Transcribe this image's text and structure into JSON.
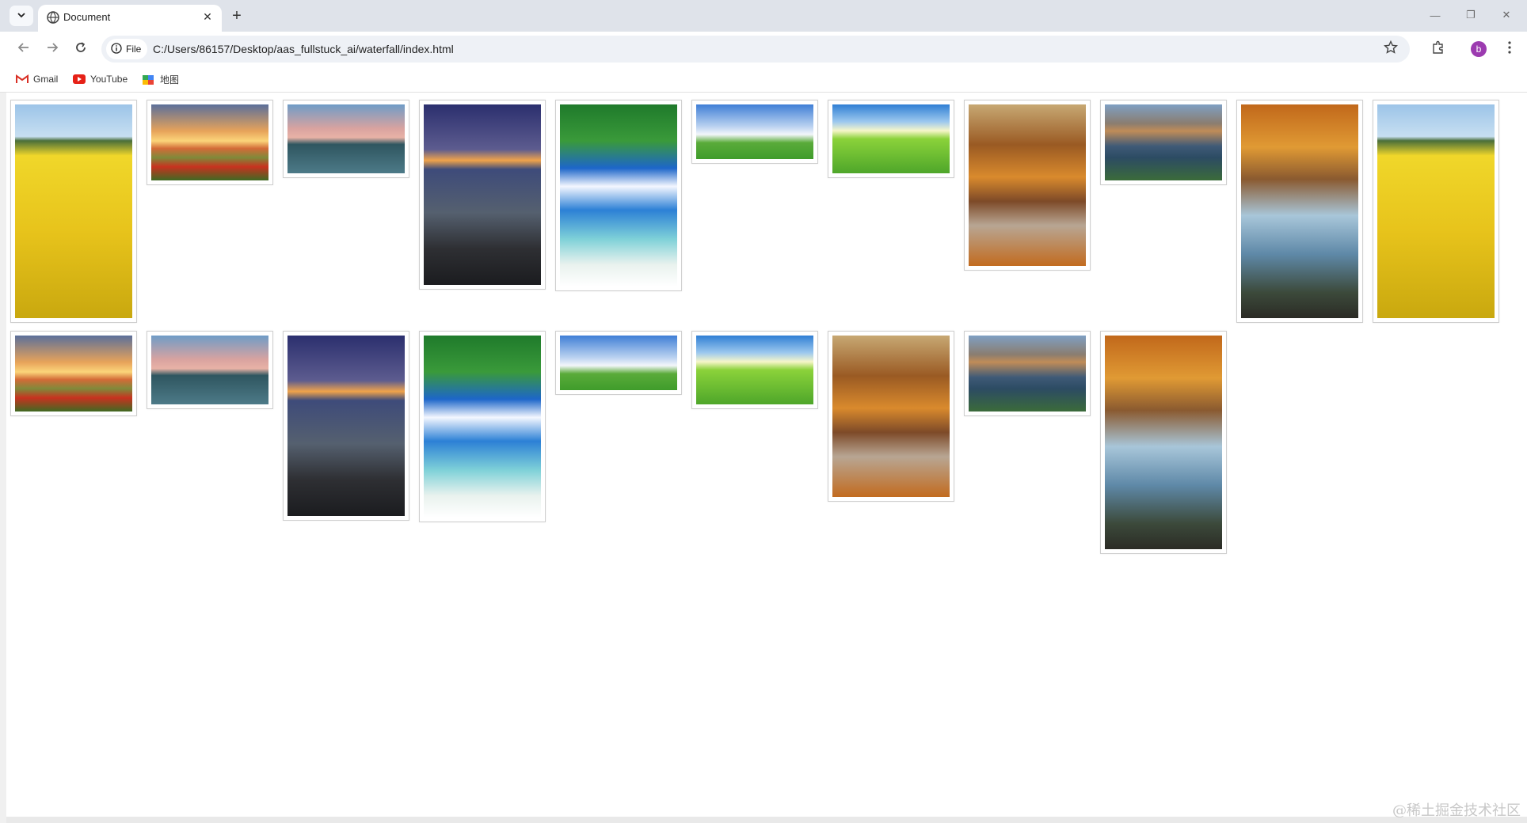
{
  "browser": {
    "tab_title": "Document",
    "new_tab_label": "+",
    "tab_close_label": "✕",
    "tab_list_label": "⌄",
    "window_controls": {
      "minimize": "—",
      "restore": "❐",
      "close": "✕"
    },
    "site_chip_label": "File",
    "url": "C:/Users/86157/Desktop/aas_fullstuck_ai/waterfall/index.html",
    "profile_initial": "b"
  },
  "bookmarks": [
    {
      "label": "Gmail",
      "icon": "gmail-icon"
    },
    {
      "label": "YouTube",
      "icon": "youtube-icon"
    },
    {
      "label": "地图",
      "icon": "maps-icon"
    }
  ],
  "gallery": {
    "row1": [
      "rapeseed",
      "sunset",
      "lake",
      "volcano",
      "beach",
      "tree",
      "meadow",
      "autumn",
      "mountain",
      "bench",
      "rapeseed"
    ],
    "row2": [
      "sunset",
      "lake",
      "volcano",
      "beach",
      "tree",
      "meadow",
      "autumn",
      "mountain",
      "bench"
    ]
  },
  "watermark": "@稀土掘金技术社区"
}
